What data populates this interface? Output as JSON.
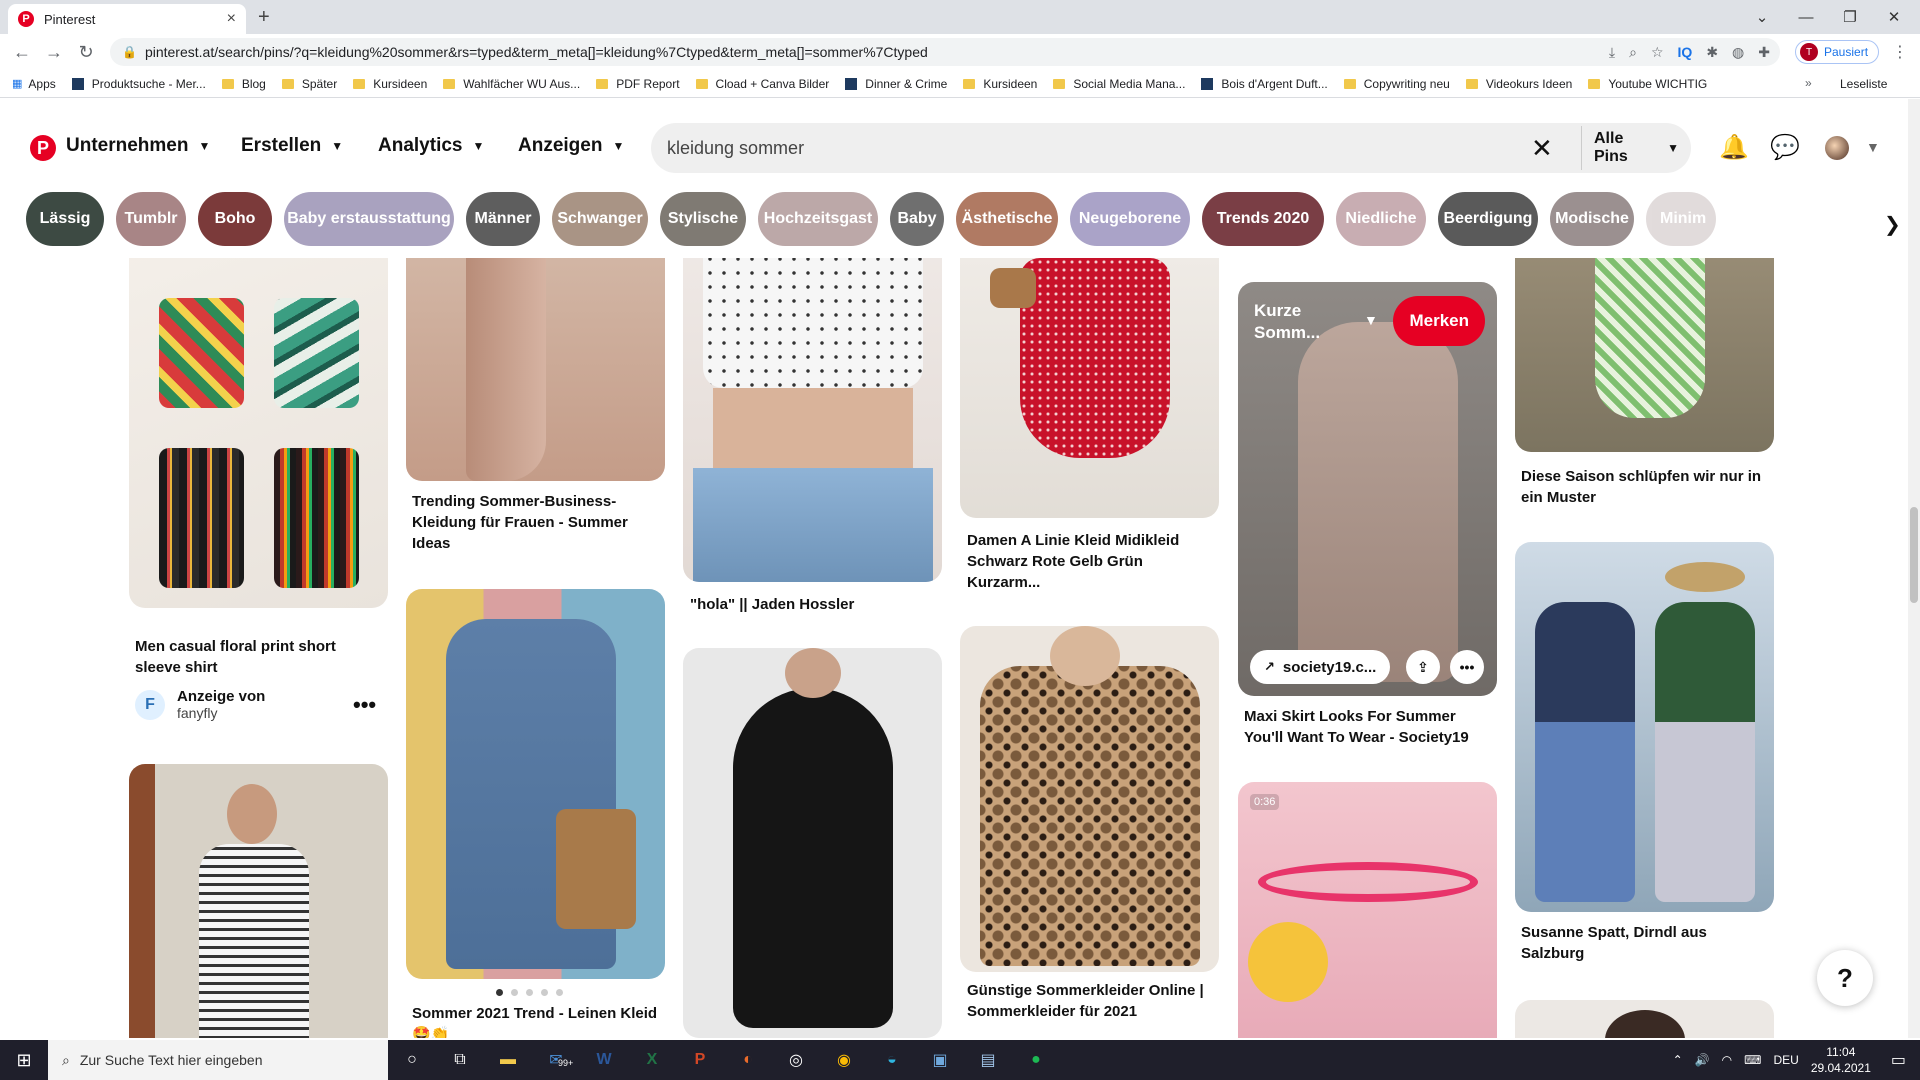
{
  "browser": {
    "tab_title": "Pinterest",
    "url": "pinterest.at/search/pins/?q=kleidung%20sommer&rs=typed&term_meta[]=kleidung%7Ctyped&term_meta[]=sommer%7Ctyped",
    "profile_label": "Pausiert",
    "profile_initial": "T"
  },
  "bookmarks": [
    {
      "label": "Apps",
      "icon": "apps-grid-icon"
    },
    {
      "label": "Produktsuche - Mer...",
      "icon": "site-icon"
    },
    {
      "label": "Blog",
      "icon": "folder-icon"
    },
    {
      "label": "Später",
      "icon": "folder-icon"
    },
    {
      "label": "Kursideen",
      "icon": "folder-icon"
    },
    {
      "label": "Wahlfächer WU Aus...",
      "icon": "folder-icon"
    },
    {
      "label": "PDF Report",
      "icon": "folder-icon"
    },
    {
      "label": "Cload + Canva Bilder",
      "icon": "folder-icon"
    },
    {
      "label": "Dinner & Crime",
      "icon": "site-icon"
    },
    {
      "label": "Kursideen",
      "icon": "folder-icon"
    },
    {
      "label": "Social Media Mana...",
      "icon": "folder-icon"
    },
    {
      "label": "Bois d'Argent Duft...",
      "icon": "site-icon"
    },
    {
      "label": "Copywriting neu",
      "icon": "folder-icon"
    },
    {
      "label": "Videokurs Ideen",
      "icon": "folder-icon"
    },
    {
      "label": "Youtube WICHTIG",
      "icon": "folder-icon"
    }
  ],
  "bookmarks_more": "»",
  "bookmarks_reading_list": "Leseliste",
  "pinterest": {
    "logo": "P",
    "nav": [
      {
        "label": "Unternehmen"
      },
      {
        "label": "Erstellen"
      },
      {
        "label": "Analytics"
      },
      {
        "label": "Anzeigen"
      }
    ],
    "search_value": "kleidung sommer",
    "search_filter": "Alle Pins",
    "brand_color": "#e60023"
  },
  "chips": [
    {
      "label": "Lässig",
      "color": "#3d4a43"
    },
    {
      "label": "Tumblr",
      "color": "#a88586"
    },
    {
      "label": "Boho",
      "color": "#7b3a3a"
    },
    {
      "label": "Baby erstausstattung",
      "color": "#a9a2bf"
    },
    {
      "label": "Männer",
      "color": "#5e5e5e"
    },
    {
      "label": "Schwanger",
      "color": "#a99485"
    },
    {
      "label": "Stylische",
      "color": "#7f7a73"
    },
    {
      "label": "Hochzeitsgast",
      "color": "#bca8a8"
    },
    {
      "label": "Baby",
      "color": "#6f6f6f"
    },
    {
      "label": "Ästhetische",
      "color": "#b07a63"
    },
    {
      "label": "Neugeborene",
      "color": "#aaa3c8"
    },
    {
      "label": "Trends 2020",
      "color": "#7a3e45"
    },
    {
      "label": "Niedliche",
      "color": "#c8adb2"
    },
    {
      "label": "Beerdigung",
      "color": "#5a5a5a"
    },
    {
      "label": "Modische",
      "color": "#9b9090"
    },
    {
      "label": "Minim",
      "color": "#d8d0d0"
    }
  ],
  "pins": {
    "c1_title": "Men casual floral print short sleeve shirt",
    "c1_ad_label": "Anzeige von",
    "c1_ad_advertiser": "fanyfly",
    "c2_title": "Trending Sommer-Business-Kleidung für Frauen - Summer Ideas",
    "c2b_title": "Sommer 2021 Trend - Leinen Kleid 🤩👏",
    "c3_title": "\"hola\" || Jaden Hossler",
    "c4_title": "Damen A Linie Kleid Midikleid Schwarz Rote Gelb Grün Kurzarm...",
    "c4b_title": "Günstige Sommerkleider Online | Sommerkleider für 2021",
    "c5_hover_title": "Kurze Somm...",
    "c5_save": "Merken",
    "c5_link": "society19.c...",
    "c5_title": "Maxi Skirt Looks For Summer You'll Want To Wear - Society19",
    "c5b_video": "0:36",
    "c6_title": "Diese Saison schlüpfen wir nur in ein Muster",
    "c6b_title": "Susanne Spatt, Dirndl aus Salzburg"
  },
  "help_label": "?",
  "taskbar": {
    "search_placeholder": "Zur Suche Text hier eingeben",
    "language": "DEU",
    "time": "11:04",
    "date": "29.04.2021",
    "badge": "99+"
  }
}
